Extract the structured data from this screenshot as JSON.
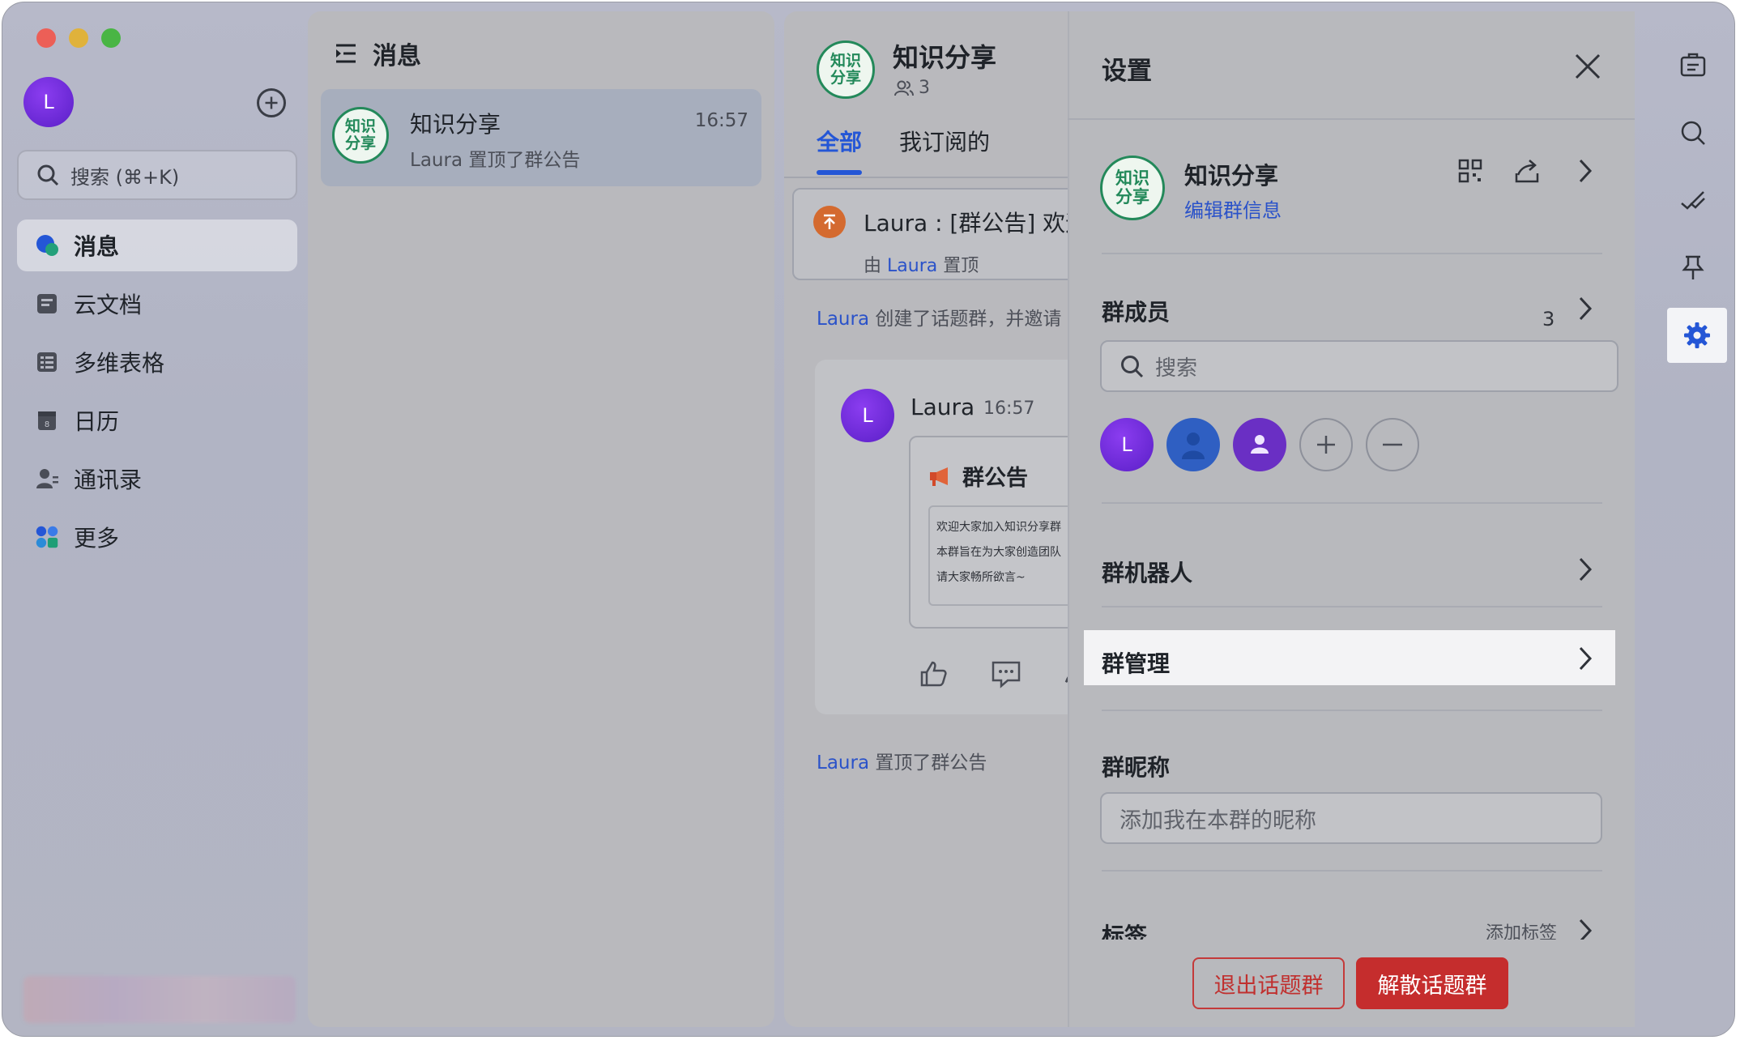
{
  "sidebar": {
    "avatar_letter": "L",
    "search_placeholder": "搜索 (⌘+K)",
    "items": [
      {
        "label": "消息"
      },
      {
        "label": "云文档"
      },
      {
        "label": "多维表格"
      },
      {
        "label": "日历"
      },
      {
        "label": "通讯录"
      },
      {
        "label": "更多"
      }
    ]
  },
  "message_list": {
    "title": "消息",
    "chats": [
      {
        "avatar_text": "知识分享",
        "name": "知识分享",
        "time": "16:57",
        "preview": "Laura 置顶了群公告"
      }
    ]
  },
  "chat": {
    "avatar_text": "知识分享",
    "title": "知识分享",
    "member_count": "3",
    "tabs": [
      {
        "label": "全部"
      },
      {
        "label": "我订阅的"
      }
    ],
    "pinned": {
      "text": "Laura : [群公告] 欢迎",
      "by_prefix": "由",
      "by_user": "Laura",
      "by_suffix": "置顶"
    },
    "system_messages": [
      {
        "user": "Laura",
        "text": "创建了话题群，并邀请"
      },
      {
        "user": "Laura",
        "text": "置顶了群公告"
      }
    ],
    "message": {
      "avatar_letter": "L",
      "sender": "Laura",
      "time": "16:57",
      "notice_title": "群公告",
      "notice_lines": [
        "欢迎大家加入知识分享群",
        "本群旨在为大家创造团队",
        "请大家畅所欲言~"
      ]
    }
  },
  "settings": {
    "title": "设置",
    "group": {
      "avatar_text": "知识分享",
      "name": "知识分享",
      "edit_label": "编辑群信息"
    },
    "members": {
      "label": "群成员",
      "count": "3",
      "search_placeholder": "搜索",
      "avatars": [
        {
          "letter": "L"
        },
        {
          "letter": ""
        },
        {
          "letter": ""
        }
      ]
    },
    "bots_label": "群机器人",
    "manage_label": "群管理",
    "nickname": {
      "label": "群昵称",
      "placeholder": "添加我在本群的昵称"
    },
    "tags": {
      "label": "标签",
      "add_label": "添加标签"
    },
    "exit_label": "退出话题群",
    "dissolve_label": "解散话题群"
  },
  "colors": {
    "accent": "#2456d6",
    "group_green": "#23895a",
    "danger": "#c52d2d",
    "avatar_purple": "#6a2fc4"
  }
}
